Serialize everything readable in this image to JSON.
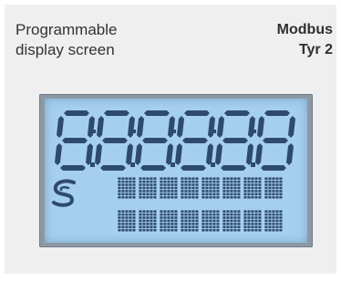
{
  "header": {
    "left_line1": "Programmable",
    "left_line2": "display screen",
    "right_line1": "Modbus",
    "right_line2": "Tyr 2"
  },
  "lcd": {
    "digits": [
      "8",
      "8",
      "8",
      "8",
      "8",
      "8"
    ],
    "segment_color": "#2e4a6e",
    "background_color": "#a5cfee",
    "logo_icon": "s-logo-icon",
    "matrix_rows": 2,
    "matrix_cells_per_row": 8
  }
}
